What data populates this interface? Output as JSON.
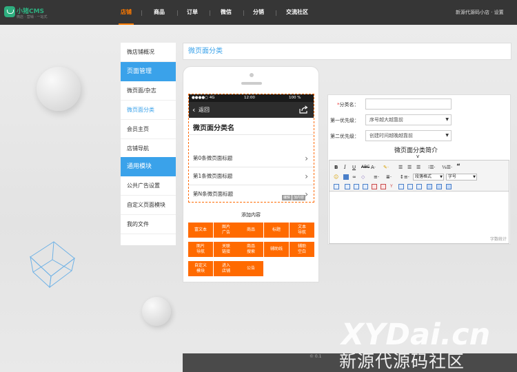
{
  "header": {
    "logo_text": "小猪CMS",
    "logo_sub": "微店 · 营销 · 一站式",
    "nav": [
      "店铺",
      "商品",
      "订单",
      "微信",
      "分销",
      "交流社区"
    ],
    "shop_link": "新源代源码小店 · 设置"
  },
  "sidebar": {
    "items": [
      {
        "label": "微店铺概况"
      },
      {
        "label": "页面管理",
        "group": true
      },
      {
        "label": "微页面/杂志"
      },
      {
        "label": "微页面分类",
        "active": true
      },
      {
        "label": "会员主页"
      },
      {
        "label": "店铺导航"
      },
      {
        "label": "通用模块",
        "group": true
      },
      {
        "label": "公共广告设置"
      },
      {
        "label": "自定义页面模块"
      },
      {
        "label": "我的文件"
      }
    ]
  },
  "page_title": "微页面分类",
  "phone": {
    "status": {
      "signal": "●●●●○ 4G",
      "time": "12:00",
      "battery": "100 %"
    },
    "back_label": "返回",
    "title": "微页面分类名",
    "rows": [
      "第0条微页面标题",
      "第1条微页面标题",
      "第N条微页面标题"
    ],
    "edit_tags": [
      "编辑",
      "加内容"
    ],
    "add_title": "添加内容",
    "tiles": [
      [
        "富文本",
        "图片\n广告",
        "商品",
        "标题",
        "文本\n导航"
      ],
      [
        "图片\n导航",
        "关联\n链接",
        "商品\n搜索",
        "辅助线",
        "辅助\n空白"
      ],
      [
        "自定义\n模块",
        "进入\n店铺",
        "公告"
      ]
    ]
  },
  "form": {
    "name_label": "分类名：",
    "name_required": "*",
    "name_value": "",
    "priority1_label": "第一优先级：",
    "priority1_value": "序号越大越靠前",
    "priority2_label": "第二优先级：",
    "priority2_value": "创建时间越晚越靠前",
    "intro_label": "微页面分类简介",
    "intro_caret": "v",
    "word_count": "字数统计",
    "toolbar": {
      "paragraph": "段落格式",
      "fontsize": "字号"
    }
  },
  "footer": {
    "text": "© 0.1"
  },
  "watermark": {
    "en": "XYDai.cn",
    "cn": "新源代源码社区"
  },
  "colors": {
    "accent": "#3aa2ea",
    "orange": "#ff6a00",
    "topbar": "#363636"
  }
}
